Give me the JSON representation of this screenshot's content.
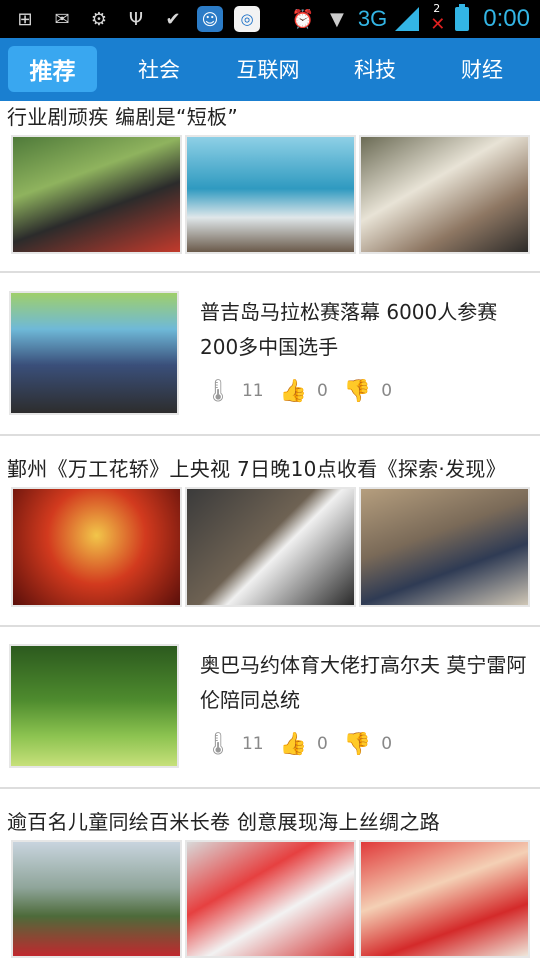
{
  "status_bar": {
    "network": "3G",
    "notification_count": "2",
    "time": "0:00"
  },
  "tabs": [
    {
      "label": "推荐",
      "active": true
    },
    {
      "label": "社会",
      "active": false
    },
    {
      "label": "互联网",
      "active": false
    },
    {
      "label": "科技",
      "active": false
    },
    {
      "label": "财经",
      "active": false
    }
  ],
  "feed": {
    "items": [
      {
        "type": "gallery",
        "title": "行业剧顽疾 编剧是“短板”",
        "thumb_names": [
          "drama-still-1",
          "drama-still-2",
          "drama-still-3"
        ]
      },
      {
        "type": "single",
        "title": "普吉岛马拉松赛落幕 6000人参赛200多中国选手",
        "views": "11",
        "likes": "0",
        "dislikes": "0"
      },
      {
        "type": "gallery",
        "title": "鄞州《万工花轿》上央视 7日晚10点收看《探索·发现》",
        "thumb_names": [
          "sedan-chair-photo",
          "filming-photo-1",
          "filming-photo-2"
        ]
      },
      {
        "type": "single",
        "title": "奥巴马约体育大佬打高尔夫 莫宁雷阿伦陪同总统",
        "views": "11",
        "likes": "0",
        "dislikes": "0"
      },
      {
        "type": "gallery",
        "title": "逾百名儿童同绘百米长卷 创意展现海上丝绸之路",
        "thumb_names": [
          "children-event-1",
          "children-event-2",
          "children-event-3"
        ]
      }
    ]
  },
  "icons": {
    "views": "thermometer-icon",
    "likes": "thumbs-up-icon",
    "dislikes": "thumbs-down-icon"
  },
  "colors": {
    "tab_bar": "#1a7fd0",
    "tab_active": "#39a7f0",
    "status_accent": "#33b5e5"
  }
}
